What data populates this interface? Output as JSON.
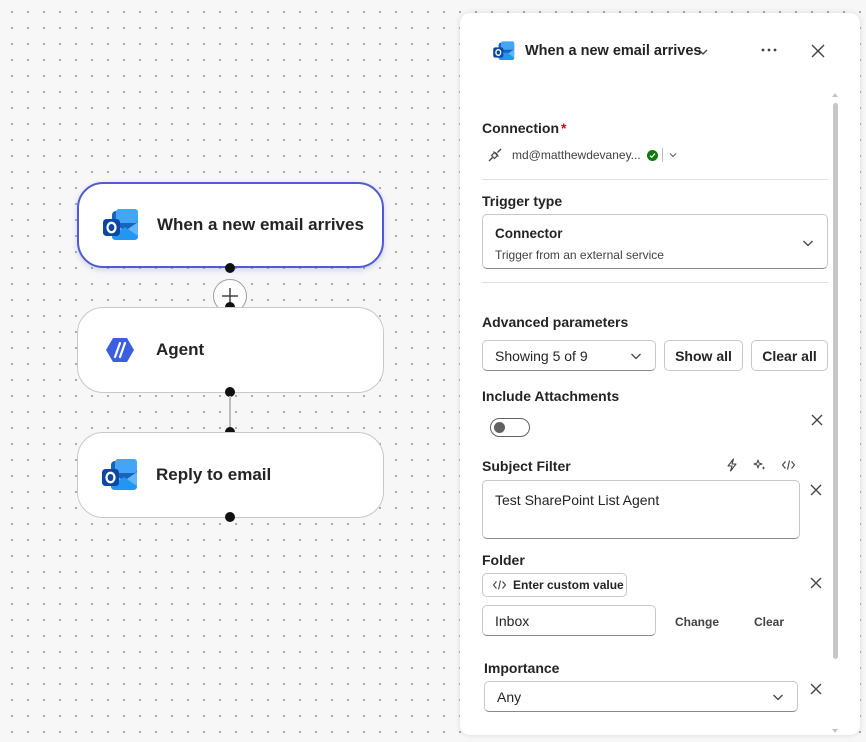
{
  "flow": {
    "nodes": [
      {
        "title": "When a new email arrives",
        "icon": "outlook-icon"
      },
      {
        "title": "Agent",
        "icon": "agent-icon"
      },
      {
        "title": "Reply to email",
        "icon": "outlook-icon"
      }
    ],
    "add_button_icon": "plus-icon"
  },
  "panel": {
    "title": "When a new email arrives",
    "connection": {
      "label": "Connection",
      "required_mark": "*",
      "account": "md@matthewdevaney..."
    },
    "trigger_type": {
      "label": "Trigger type",
      "value": "Connector",
      "description": "Trigger from an external service"
    },
    "advanced": {
      "label": "Advanced parameters",
      "showing": "Showing 5 of 9",
      "show_all": "Show all",
      "clear_all": "Clear all"
    },
    "include_attachments": {
      "label": "Include Attachments",
      "enabled": false
    },
    "subject_filter": {
      "label": "Subject Filter",
      "value": "Test SharePoint List Agent"
    },
    "folder": {
      "label": "Folder",
      "custom_value": "Enter custom value",
      "value": "Inbox",
      "change": "Change",
      "clear": "Clear"
    },
    "importance": {
      "label": "Importance",
      "value": "Any"
    }
  },
  "colors": {
    "accent": "#4f5bd5",
    "required": "#c50f1f",
    "connected": "#107c10"
  }
}
